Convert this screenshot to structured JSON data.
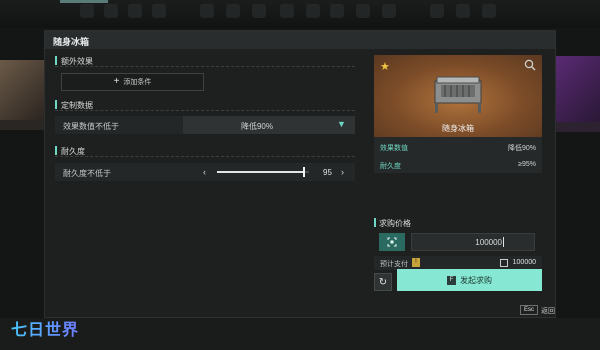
{
  "modal": {
    "title": "随身冰箱"
  },
  "sections": {
    "extra": {
      "label": "额外效果",
      "add_button": "添加条件"
    },
    "custom": {
      "label": "定制数据",
      "row_label": "效果数值不低于",
      "select_value": "降低90%"
    },
    "durability": {
      "label": "耐久度",
      "row_label": "耐久度不低于",
      "slider_value": "95",
      "slider_level_pct": 95
    }
  },
  "item": {
    "name": "随身冰箱",
    "stats": [
      {
        "key": "效果数值",
        "value": "降低90%"
      },
      {
        "key": "耐久度",
        "value": "≥95%"
      }
    ]
  },
  "purchase": {
    "label": "求购价格",
    "price_value": "100000",
    "estimate_label": "预计支付",
    "estimate_value": "100000",
    "submit_label": "发起求购",
    "submit_key": "F"
  },
  "footer": {
    "esc_key": "Esc",
    "esc_label": "返回"
  },
  "logo": {
    "text": "七日世界"
  },
  "colors": {
    "accent": "#6fd8c4",
    "submit": "#86e8d2",
    "star": "#f0c341"
  }
}
